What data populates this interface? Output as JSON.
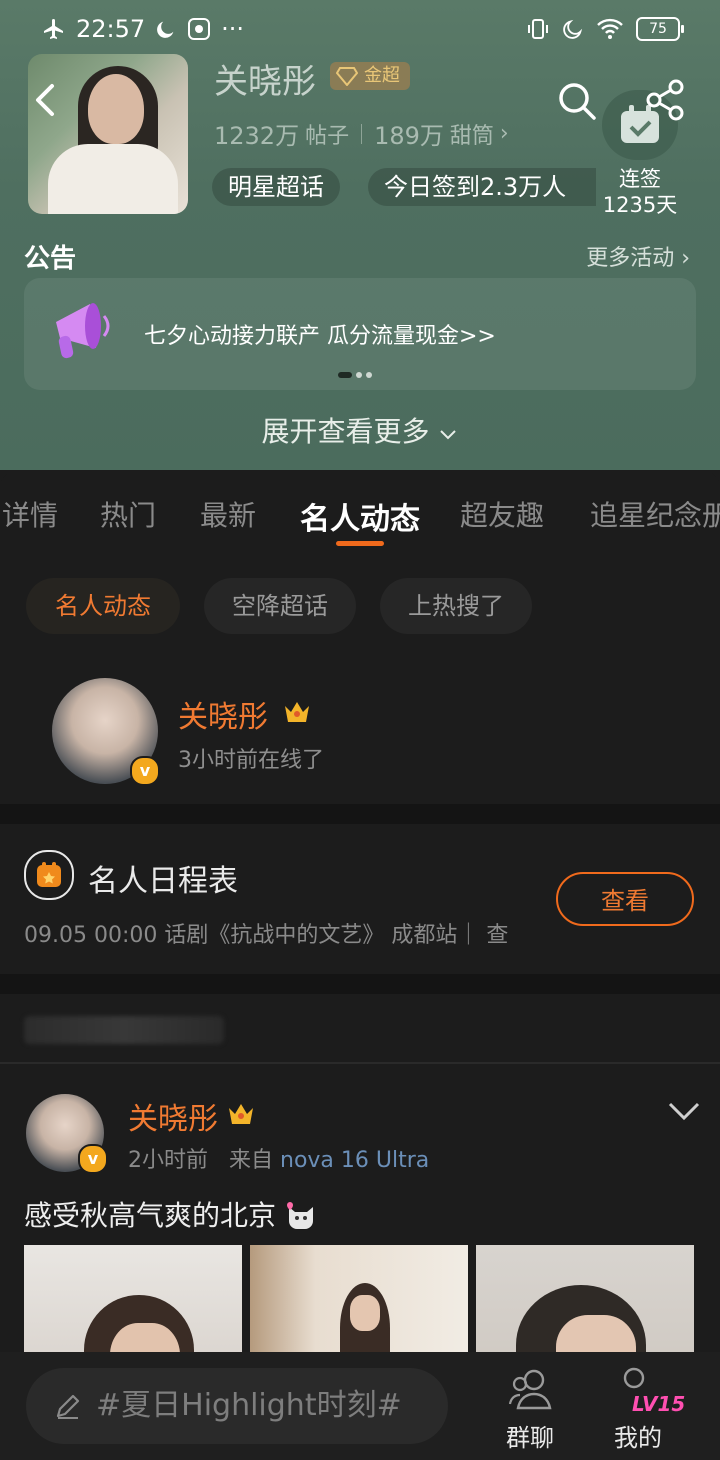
{
  "status_bar": {
    "time": "22:57",
    "dots": "···",
    "battery": "75"
  },
  "header": {
    "name": "关晓彤",
    "badge": "金超",
    "posts_num": "1232万",
    "posts_label": "帖子",
    "fans_num": "189万",
    "fans_label": "甜筒",
    "fans_arrow": "›",
    "chip_type": "明星超话",
    "chip_checkin": "今日签到2.3万人",
    "checkin_line1": "连签",
    "checkin_line2": "1235天"
  },
  "notice": {
    "title": "公告",
    "more": "更多活动 ›",
    "text": "七夕心动接力联产 瓜分流量现金>>"
  },
  "expand_label": "展开查看更多",
  "tabs": [
    "详情",
    "热门",
    "最新",
    "名人动态",
    "超友趣",
    "追星纪念册"
  ],
  "sub_tabs": [
    "名人动态",
    "空降超话",
    "上热搜了"
  ],
  "celebrity": {
    "name": "关晓彤",
    "online": "3小时前在线了",
    "v": "v"
  },
  "schedule": {
    "title": "名人日程表",
    "line": "09.05 00:00 话剧《抗战中的文艺》 成都站｜ 查",
    "button": "查看"
  },
  "post": {
    "name": "关晓彤",
    "time": "2小时前",
    "from": "来自",
    "device": "nova 16 Ultra",
    "text": "感受秋高气爽的北京",
    "v": "v"
  },
  "bottom_bar": {
    "compose": "#夏日Highlight时刻#",
    "group_chat": "群聊",
    "me": "我的",
    "level": "LV15"
  }
}
